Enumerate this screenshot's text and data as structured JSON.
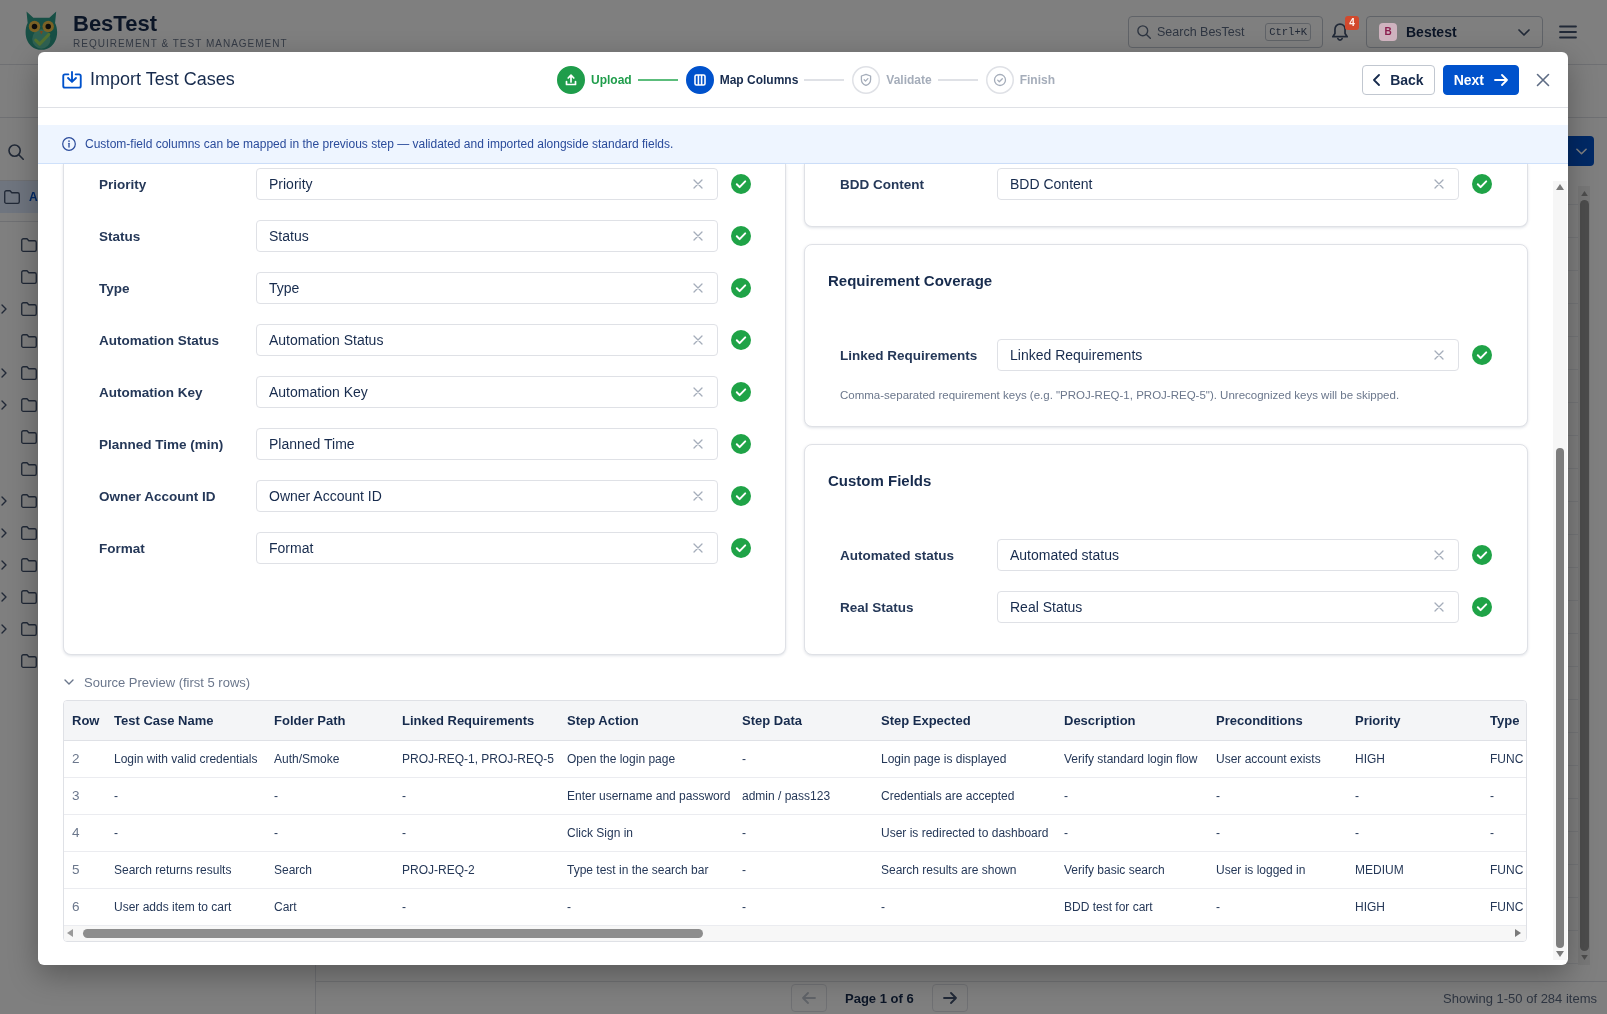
{
  "app": {
    "brand": {
      "name": "BesTest",
      "tagline": "REQUIREMENT & TEST MANAGEMENT"
    },
    "search": {
      "placeholder": "Search BesTest",
      "shortcut": "Ctrl+K"
    },
    "notifications": {
      "count": "4"
    },
    "user": {
      "initial": "B",
      "name": "Bestest"
    },
    "sidebar": {
      "all_item": {
        "label": "A",
        "selected": true
      },
      "folders": [
        {
          "has_children": false,
          "selected": false
        },
        {
          "has_children": false,
          "selected": false
        },
        {
          "has_children": true,
          "selected": false
        },
        {
          "has_children": false,
          "selected": false
        },
        {
          "has_children": true,
          "selected": false
        },
        {
          "has_children": true,
          "selected": false
        },
        {
          "has_children": false,
          "selected": false
        },
        {
          "has_children": false,
          "selected": false
        },
        {
          "has_children": true,
          "selected": false
        },
        {
          "has_children": true,
          "selected": false
        },
        {
          "has_children": true,
          "selected": false
        },
        {
          "has_children": true,
          "selected": false
        },
        {
          "has_children": true,
          "selected": false
        },
        {
          "has_children": false,
          "selected": false
        }
      ]
    },
    "pagination": {
      "previous": {
        "disabled": true
      },
      "page": "Page 1 of 6",
      "next": {
        "disabled": false
      },
      "summary": "Showing 1-50 of 284 items"
    }
  },
  "dialog": {
    "title": "Import Test Cases",
    "steps": [
      {
        "label": "Upload",
        "completed": true,
        "current": false
      },
      {
        "label": "Map Columns",
        "completed": false,
        "current": true
      },
      {
        "label": "Validate",
        "completed": false,
        "current": false
      },
      {
        "label": "Finish",
        "completed": false,
        "current": false
      }
    ],
    "actions": [
      {
        "label": "Back",
        "kind": "back"
      },
      {
        "label": "Next",
        "kind": "next"
      }
    ],
    "notice": "Custom-field columns can be mapped in the previous step — validated and imported alongside standard fields.",
    "mapping_columns": [
      {
        "cards": [
          {
            "fields": [
              {
                "label": "Priority",
                "value": "Priority",
                "mapped": true
              },
              {
                "label": "Status",
                "value": "Status",
                "mapped": true
              },
              {
                "label": "Type",
                "value": "Type",
                "mapped": true
              },
              {
                "label": "Automation Status",
                "value": "Automation Status",
                "mapped": true
              },
              {
                "label": "Automation Key",
                "value": "Automation Key",
                "mapped": true
              },
              {
                "label": "Planned Time (min)",
                "value": "Planned Time",
                "mapped": true
              },
              {
                "label": "Owner Account ID",
                "value": "Owner Account ID",
                "mapped": true
              },
              {
                "label": "Format",
                "value": "Format",
                "mapped": true
              }
            ]
          }
        ]
      },
      {
        "cards": [
          {
            "fields": [
              {
                "label": "BDD Content",
                "value": "BDD Content",
                "mapped": true
              }
            ]
          },
          {
            "title": "Requirement Coverage",
            "fields": [
              {
                "label": "Linked Requirements",
                "value": "Linked Requirements",
                "mapped": true
              }
            ],
            "hint": "Comma-separated requirement keys (e.g. \"PROJ-REQ-1, PROJ-REQ-5\"). Unrecognized keys will be skipped."
          },
          {
            "title": "Custom Fields",
            "fields": [
              {
                "label": "Automated status",
                "value": "Automated status",
                "mapped": true
              },
              {
                "label": "Real Status",
                "value": "Real Status",
                "mapped": true
              }
            ]
          }
        ]
      }
    ],
    "preview": {
      "title": "Source Preview (first 5 rows)",
      "expanded": true,
      "columns": [
        "Row",
        "Test Case Name",
        "Folder Path",
        "Linked Requirements",
        "Step Action",
        "Step Data",
        "Step Expected",
        "Description",
        "Preconditions",
        "Priority",
        "Type"
      ],
      "rows": [
        [
          "2",
          "Login with valid credentials",
          "Auth/Smoke",
          "PROJ-REQ-1, PROJ-REQ-5",
          "Open the login page",
          "-",
          "Login page is displayed",
          "Verify standard login flow",
          "User account exists",
          "HIGH",
          "FUNC"
        ],
        [
          "3",
          "-",
          "-",
          "-",
          "Enter username and password",
          "admin / pass123",
          "Credentials are accepted",
          "-",
          "-",
          "-",
          "-"
        ],
        [
          "4",
          "-",
          "-",
          "-",
          "Click Sign in",
          "-",
          "User is redirected to dashboard",
          "-",
          "-",
          "-",
          "-"
        ],
        [
          "5",
          "Search returns results",
          "Search",
          "PROJ-REQ-2",
          "Type test in the search bar",
          "-",
          "Search results are shown",
          "Verify basic search",
          "User is logged in",
          "MEDIUM",
          "FUNC"
        ],
        [
          "6",
          "User adds item to cart",
          "Cart",
          "-",
          "-",
          "-",
          "-",
          "BDD test for cart",
          "-",
          "HIGH",
          "FUNC"
        ]
      ]
    }
  }
}
